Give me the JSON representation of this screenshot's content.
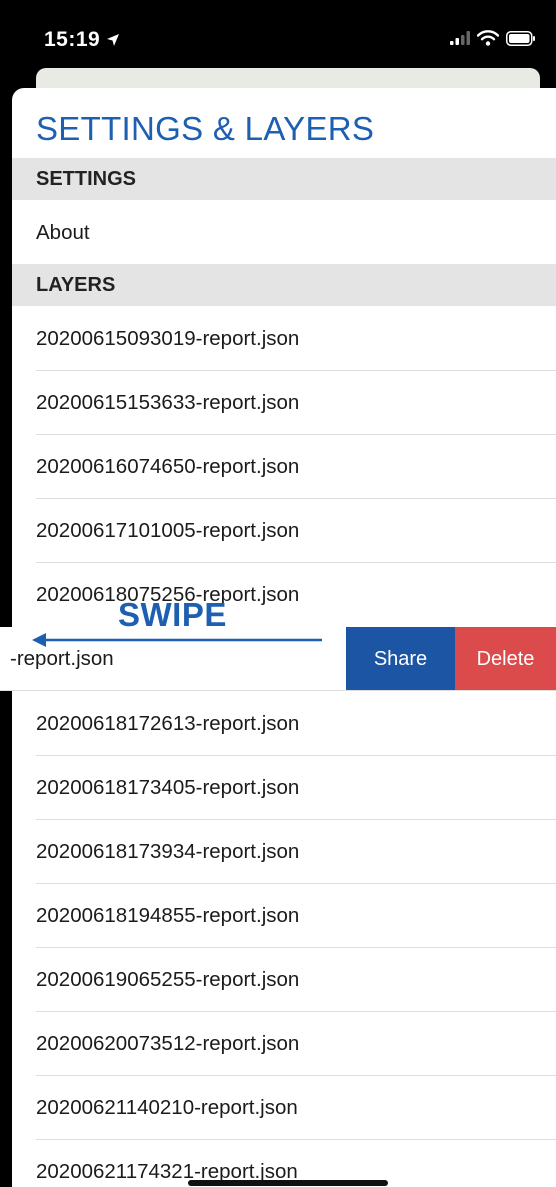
{
  "status_bar": {
    "time": "15:19",
    "icons": [
      "location-arrow-icon",
      "cellular-signal-icon",
      "wifi-icon",
      "battery-icon"
    ]
  },
  "sheet": {
    "title": "SETTINGS & LAYERS",
    "settings_section": {
      "header": "SETTINGS",
      "items": [
        "About"
      ]
    },
    "layers_section": {
      "header": "LAYERS",
      "items_before": [
        "20200615093019-report.json",
        "20200615153633-report.json",
        "20200616074650-report.json",
        "20200617101005-report.json",
        "20200618075256-report.json"
      ],
      "swiped_item": {
        "visible_label": "-report.json",
        "actions": {
          "share": "Share",
          "delete": "Delete"
        }
      },
      "items_after": [
        "20200618172613-report.json",
        "20200618173405-report.json",
        "20200618173934-report.json",
        "20200618194855-report.json",
        "20200619065255-report.json",
        "20200620073512-report.json",
        "20200621140210-report.json",
        "20200621174321-report.json"
      ]
    }
  },
  "annotation": {
    "text": "SWIPE",
    "color": "#1d5fb0"
  },
  "colors": {
    "title": "#1d5fb0",
    "share": "#1d55a5",
    "delete": "#dc4b4b",
    "section_header_bg": "#e4e4e4"
  }
}
